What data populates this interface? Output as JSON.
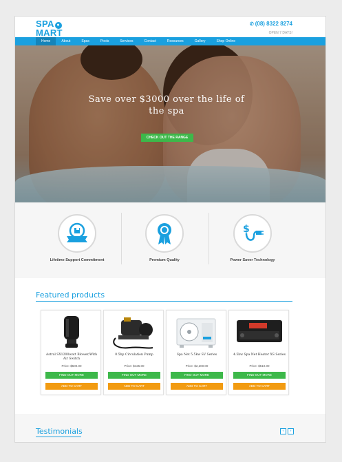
{
  "header": {
    "logo_line1": "SPA",
    "logo_line2": "MART",
    "phone": "(08) 8322 8274",
    "hours": "OPEN 7 DAYS!"
  },
  "nav": {
    "items": [
      {
        "label": "Home",
        "active": true
      },
      {
        "label": "About"
      },
      {
        "label": "Spas"
      },
      {
        "label": "Pools"
      },
      {
        "label": "Services"
      },
      {
        "label": "Contact"
      },
      {
        "label": "Resources"
      },
      {
        "label": "Gallery"
      },
      {
        "label": "Shop Online"
      }
    ]
  },
  "hero": {
    "headline": "Save over $3000 over the life of the spa",
    "cta": "CHECK OUT THE RANGE"
  },
  "features": [
    {
      "label": "Lifetime Support Commitment",
      "icon": "support-banner-icon"
    },
    {
      "label": "Premium Quality",
      "icon": "award-ribbon-icon"
    },
    {
      "label": "Power Saver Technology",
      "icon": "dollar-plug-icon"
    }
  ],
  "featured": {
    "title": "Featured products",
    "products": [
      {
        "name": "Astral SX1200watt Blower/With Air Switch",
        "price": "Price: $500.00",
        "more": "FIND OUT MORE",
        "cart": "ADD TO CART"
      },
      {
        "name": "0.5hp Circulation Pump",
        "price": "Price: $425.00",
        "more": "FIND OUT MORE",
        "cart": "ADD TO CART"
      },
      {
        "name": "Spa Net 5.5kw SV Series",
        "price": "Price: $2,200.00",
        "more": "FIND OUT MORE",
        "cart": "ADD TO CART"
      },
      {
        "name": "4.5kw Spa Net Heater XS Series",
        "price": "Price: $510.00",
        "more": "FIND OUT MORE",
        "cart": "ADD TO CART"
      }
    ]
  },
  "testimonials": {
    "title": "Testimonials",
    "prev": "‹",
    "next": "›"
  },
  "colors": {
    "accent": "#1aa0df",
    "green": "#3db84a",
    "orange": "#f29b11"
  }
}
